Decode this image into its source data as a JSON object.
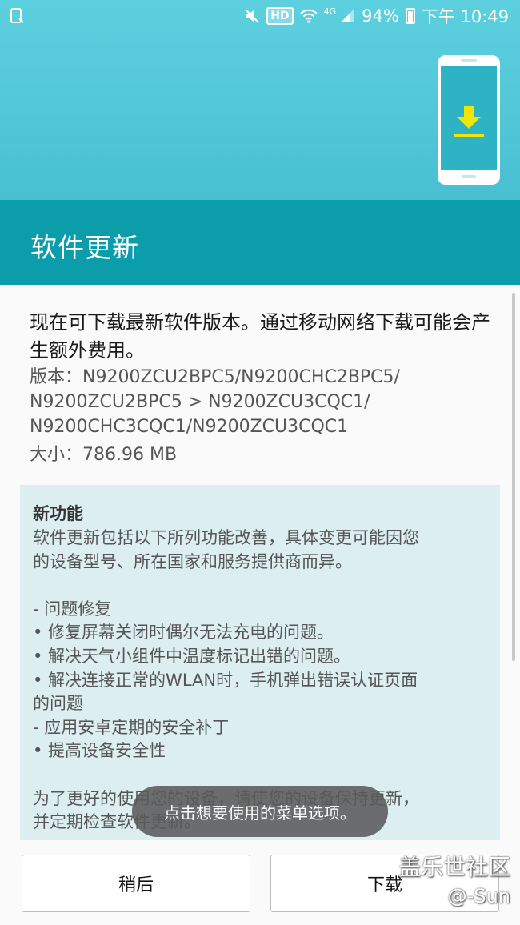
{
  "status_bar": {
    "hd": "HD",
    "network": "4G",
    "battery": "94%",
    "time": "下午 10:49"
  },
  "header": {
    "title": "软件更新"
  },
  "content": {
    "intro": "现在可下载最新软件版本。通过移动网络下载可能会产生额外费用。",
    "version_lines": [
      "版本：N9200ZCU2BPC5/N9200CHC2BPC5/",
      "N9200ZCU2BPC5 > N9200ZCU3CQC1/",
      "N9200CHC3CQC1/N9200ZCU3CQC1"
    ],
    "size": "大小：786.96 MB",
    "new_features": {
      "title": "新功能",
      "lines": [
        "软件更新包括以下所列功能改善，具体变更可能因您",
        "的设备型号、所在国家和服务提供商而异。",
        "",
        "- 问题修复",
        "• 修复屏幕关闭时偶尔无法充电的问题。",
        "• 解决天气小组件中温度标记出错的问题。",
        "• 解决连接正常的WLAN时，手机弹出错误认证页面",
        "的问题",
        "- 应用安卓定期的安全补丁",
        "• 提高设备安全性",
        "",
        "为了更好的使用您的设备，请使您的设备保持更新，",
        "并定期检查软件更新。"
      ]
    }
  },
  "toast": "点击想要使用的菜单选项。",
  "buttons": {
    "later": "稍后",
    "download": "下载"
  },
  "watermark": {
    "line1": "盖乐世社区",
    "line2": "@-Sun"
  },
  "colors": {
    "banner": "#5dd0df",
    "titlebar": "#0c9dab",
    "download_arrow": "#f2e600"
  }
}
